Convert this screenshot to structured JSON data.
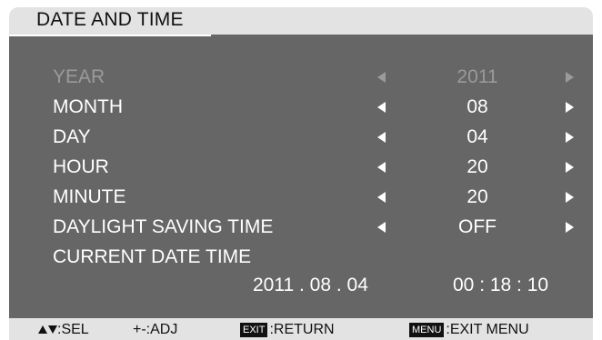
{
  "menu": {
    "title": "DATE AND TIME",
    "rows": [
      {
        "label": "YEAR",
        "value": "2011",
        "enabled": false
      },
      {
        "label": "MONTH",
        "value": "08",
        "enabled": true
      },
      {
        "label": "DAY",
        "value": "04",
        "enabled": true
      },
      {
        "label": "HOUR",
        "value": "20",
        "enabled": true
      },
      {
        "label": "MINUTE",
        "value": "20",
        "enabled": true
      },
      {
        "label": "DAYLIGHT SAVING TIME",
        "value": "OFF",
        "enabled": true
      }
    ],
    "current_label": "CURRENT DATE TIME",
    "current_date": "2011 . 08 . 04",
    "current_time": "00 : 18 : 10"
  },
  "footer": {
    "sel": ":SEL",
    "adj": "+-:ADJ",
    "exit_key": "EXIT",
    "return": ":RETURN",
    "menu_key": "MENU",
    "exit_menu": ":EXIT MENU"
  },
  "colors": {
    "panel": "#666666",
    "title_bar": "#e3e3e3",
    "text": "#ffffff",
    "disabled_text": "#9a9a9a"
  }
}
